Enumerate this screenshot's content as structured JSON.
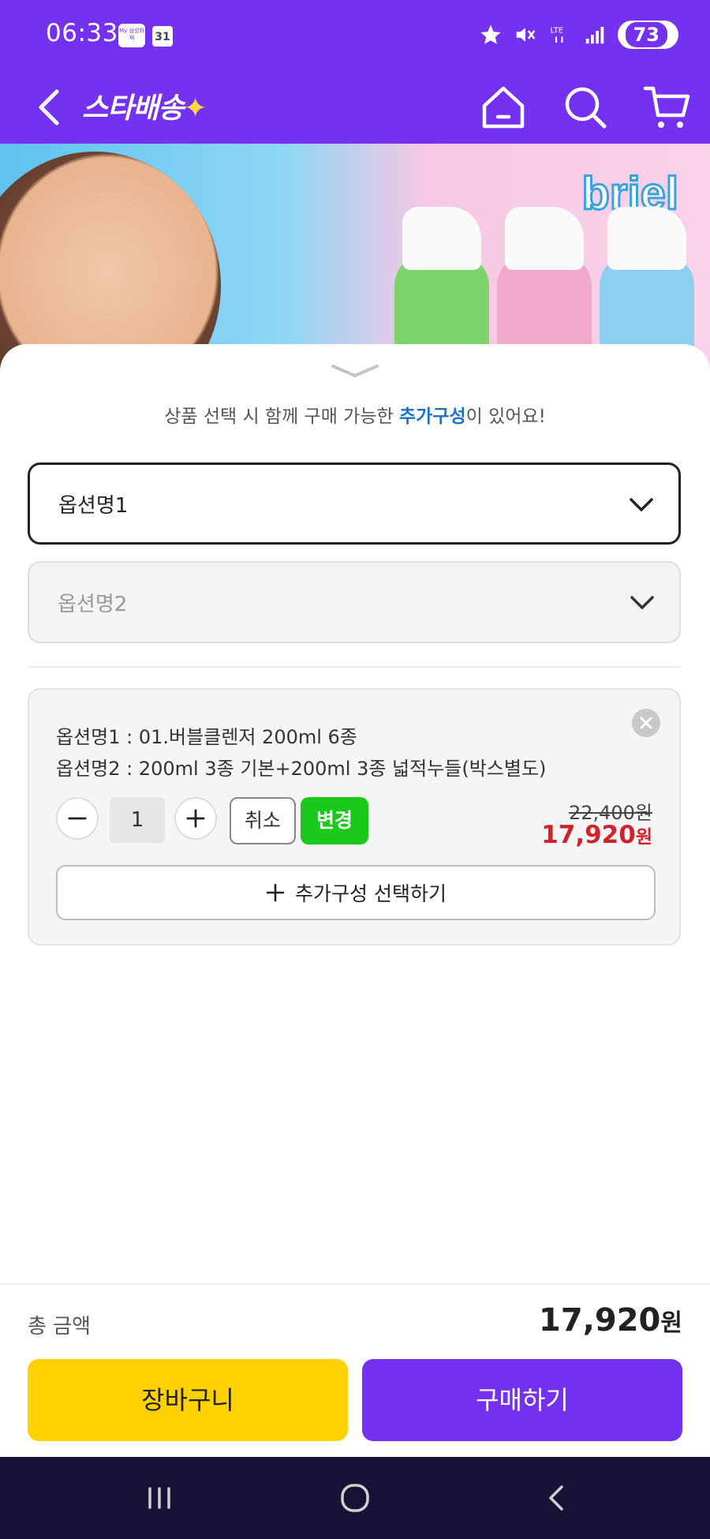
{
  "status_bar": {
    "time": "06:33",
    "app_badge_text": "My 삼성화재",
    "calendar_day": "31",
    "battery": "73"
  },
  "header": {
    "logo_text": "스타배송",
    "logo_star": "✦"
  },
  "banner": {
    "brand": "briel"
  },
  "sheet": {
    "notice_prefix": "상품 선택 시 함께 구매 가능한 ",
    "notice_highlight": "추가구성",
    "notice_suffix": "이 있어요!",
    "option1_label": "옵션명1",
    "option2_placeholder": "옵션명2"
  },
  "selected_option": {
    "line1": "옵션명1 : 01.버블클렌저 200ml 6종",
    "line2": "옵션명2 : 200ml 3종 기본+200ml 3종 넓적누들(박스별도)",
    "quantity": "1",
    "cancel_label": "취소",
    "change_label": "변경",
    "original_price": "22,400원",
    "sale_price": "17,920",
    "sale_unit": "원",
    "add_config_label": "추가구성 선택하기"
  },
  "summary": {
    "total_label": "총 금액",
    "total_value": "17,920",
    "total_unit": "원"
  },
  "actions": {
    "cart_label": "장바구니",
    "buy_label": "구매하기"
  },
  "colors": {
    "brand_purple": "#7431f0",
    "cart_yellow": "#ffd100",
    "sale_red": "#d0222a",
    "change_green": "#1dc81d",
    "highlight_blue": "#1a73c8"
  }
}
